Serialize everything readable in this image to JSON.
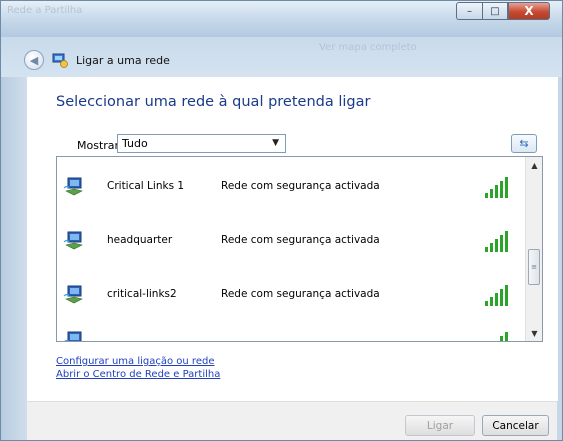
{
  "window": {
    "ghost_title": "Rede a Partilha",
    "ghost_status": "Ver mapa completo",
    "caption": {
      "minimize": "–",
      "maximize": "□",
      "close": "X"
    }
  },
  "header": {
    "title": "Ligar a uma rede"
  },
  "main": {
    "heading": "Seleccionar uma rede à qual pretenda ligar",
    "filter": {
      "label": "Mostrar",
      "value": "Tudo"
    }
  },
  "networks": [
    {
      "name": "Critical Links 1",
      "security": "Rede com segurança activada",
      "signal": 5
    },
    {
      "name": "headquarter",
      "security": "Rede com segurança activada",
      "signal": 5
    },
    {
      "name": "critical-links2",
      "security": "Rede com segurança activada",
      "signal": 5
    },
    {
      "name": "",
      "security": "",
      "signal": 2
    }
  ],
  "links": {
    "setup": "Configurar uma ligação ou rede",
    "center": "Abrir o Centro de Rede e Partilha"
  },
  "buttons": {
    "connect": "Ligar",
    "cancel": "Cancelar"
  },
  "colors": {
    "signal_green": "#2aa52a",
    "heading_blue": "#1a3b8a",
    "link_blue": "#1f3fbf"
  }
}
